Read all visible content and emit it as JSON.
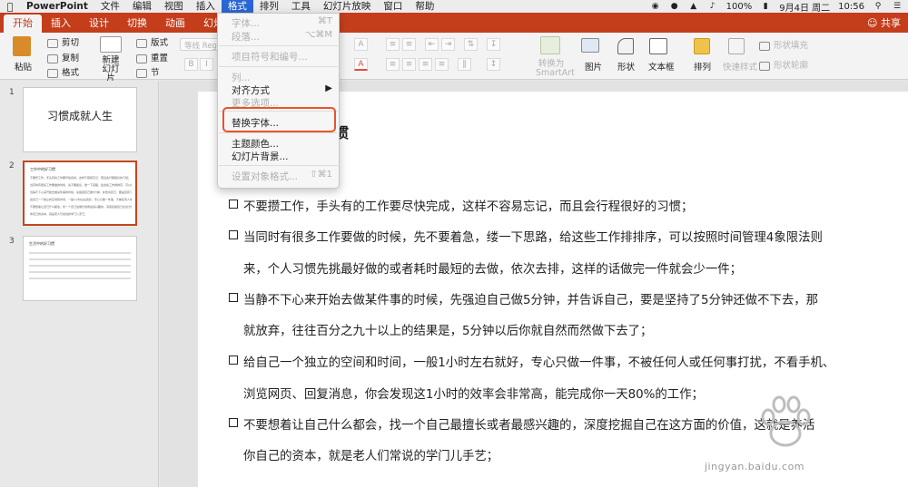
{
  "menubar": {
    "apple": "",
    "items": [
      "PowerPoint",
      "文件",
      "编辑",
      "视图",
      "插入",
      "格式",
      "排列",
      "工具",
      "幻灯片放映",
      "窗口",
      "帮助"
    ],
    "active_index": 5,
    "status": {
      "date": "9月4日 周二",
      "time": "10:56",
      "battery": "100%"
    }
  },
  "ribbon_tabs": {
    "tabs": [
      "开始",
      "插入",
      "设计",
      "切换",
      "动画",
      "幻灯片"
    ],
    "selected": "开始",
    "share": "共享"
  },
  "ribbon": {
    "paste": "粘贴",
    "cut": "剪切",
    "copy": "复制",
    "format_painter": "格式",
    "new_slide": "新建\n幻灯片",
    "layout": "版式",
    "reset": "重置",
    "section": "节",
    "font_box": "等线 Regular",
    "convert_smartart": "转换为\nSmartArt",
    "picture": "图片",
    "shape": "形状",
    "textbox": "文本框",
    "arrange": "排列",
    "quick_styles": "快速样式",
    "shape_fill": "形状填充",
    "shape_outline": "形状轮廓"
  },
  "format_menu": {
    "font": {
      "label": "字体...",
      "shortcut": "⌘T"
    },
    "paragraph": {
      "label": "段落...",
      "shortcut": "⌥⌘M"
    },
    "bullets": {
      "label": "项目符号和编号..."
    },
    "columns": {
      "label": "列..."
    },
    "align": {
      "label": "对齐方式",
      "arrow": "▶"
    },
    "more_options": {
      "label": "更多选项..."
    },
    "replace_fonts": {
      "label": "替换字体..."
    },
    "theme_colors": {
      "label": "主题颜色..."
    },
    "slide_background": {
      "label": "幻灯片背景..."
    },
    "format_object": {
      "label": "设置对象格式...",
      "shortcut": "⇧⌘1"
    }
  },
  "thumbnails": [
    {
      "num": "1",
      "title": "习惯成就人生"
    },
    {
      "num": "2",
      "title": "工作中的好习惯"
    },
    {
      "num": "3",
      "title": "生活中的好习惯"
    }
  ],
  "slide": {
    "title_visible": "惯",
    "lines": [
      "不要攒工作，手头有的工作要尽快完成，这样不容易忘记，而且会行程很好的习惯；",
      "当同时有很多工作要做的时候，先不要着急，缕一下思路，给这些工作排排序，可以按照时间管理4象限法则",
      "来，个人习惯先挑最好做的或者耗时最短的去做，依次去排，这样的话做完一件就会少一件；",
      "当静不下心来开始去做某件事的时候，先强迫自己做5分钟，并告诉自己，要是坚持了5分钟还做不下去，那",
      "就放弃，往往百分之九十以上的结果是，5分钟以后你就自然而然做下去了；",
      "给自己一个独立的空间和时间，一般1小时左右就好，专心只做一件事，不被任何人或任何事打扰，不看手机、",
      "浏览网页、回复消息，你会发现这1小时的效率会非常高，能完成你一天80%的工作；",
      "不要想着让自己什么都会，找一个自己最擅长或者最感兴趣的，深度挖掘自己在这方面的价值，这就是养活",
      "你自己的资本，就是老人们常说的学门儿手艺；"
    ]
  },
  "watermark": {
    "text": "jingyan.baidu.com"
  },
  "colors": {
    "ribbon_accent": "#c43e1c",
    "menu_highlight": "#2a66d4",
    "callout_border": "#e8542a"
  }
}
